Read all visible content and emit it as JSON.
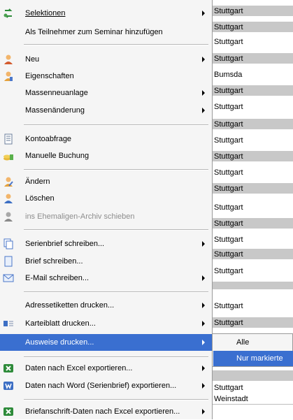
{
  "menu": {
    "items": [
      {
        "label": "Selektionen",
        "icon": "selection-icon",
        "submenu": true
      },
      {
        "label": "Als Teilnehmer zum Seminar hinzufügen"
      },
      {
        "label": "Neu",
        "icon": "new-person-icon",
        "submenu": true
      },
      {
        "label": "Eigenschaften",
        "icon": "properties-icon"
      },
      {
        "label": "Massenneuanlage",
        "submenu": true
      },
      {
        "label": "Massenänderung",
        "submenu": true
      },
      {
        "label": "Kontoabfrage",
        "icon": "account-query-icon"
      },
      {
        "label": "Manuelle Buchung",
        "icon": "manual-booking-icon"
      },
      {
        "label": "Ändern",
        "icon": "edit-person-icon"
      },
      {
        "label": "Löschen",
        "icon": "delete-person-icon"
      },
      {
        "label": "ins Ehemaligen-Archiv schieben",
        "icon": "archive-person-icon",
        "disabled": true
      },
      {
        "label": "Serienbrief schreiben...",
        "icon": "serial-letter-icon",
        "submenu": true
      },
      {
        "label": "Brief schreiben...",
        "icon": "letter-icon"
      },
      {
        "label": "E-Mail schreiben...",
        "icon": "email-icon",
        "submenu": true
      },
      {
        "label": "Adressetiketten drucken...",
        "submenu": true
      },
      {
        "label": "Karteiblatt drucken...",
        "icon": "index-card-icon",
        "submenu": true
      },
      {
        "label": "Ausweise drucken...",
        "submenu": true,
        "highlighted": true
      },
      {
        "label": "Daten nach Excel exportieren...",
        "icon": "excel-icon",
        "submenu": true
      },
      {
        "label": "Daten nach Word (Serienbrief) exportieren...",
        "icon": "word-icon",
        "submenu": true
      },
      {
        "label": "Briefanschrift-Daten nach Excel exportieren...",
        "icon": "excel-address-icon",
        "submenu": true
      }
    ]
  },
  "submenu": {
    "items": [
      {
        "label": "Alle"
      },
      {
        "label": "Nur markierte",
        "highlighted": true
      }
    ]
  },
  "grid": {
    "rows": [
      {
        "text": "Stuttgart"
      },
      {
        "text": "Stuttgart"
      },
      {
        "text": "Stuttgart"
      },
      {
        "text": "Stuttgart"
      },
      {
        "text": "Bumsda"
      },
      {
        "text": "Stuttgart"
      },
      {
        "text": "Stuttgart"
      },
      {
        "text": "Stuttgart"
      },
      {
        "text": "Stuttgart"
      },
      {
        "text": "Stuttgart"
      },
      {
        "text": "Stuttgart"
      },
      {
        "text": "Stuttgart"
      },
      {
        "text": "Stuttgart"
      },
      {
        "text": "Stuttgart"
      },
      {
        "text": "Stuttgart"
      },
      {
        "text": "Stuttgart"
      },
      {
        "text": "Stuttgart"
      },
      {
        "text": ""
      },
      {
        "text": ""
      },
      {
        "text": "Stuttgart"
      },
      {
        "text": "Stuttgart"
      },
      {
        "text": ""
      },
      {
        "text": ""
      },
      {
        "text": ""
      },
      {
        "text": ""
      },
      {
        "text": ""
      },
      {
        "text": ""
      },
      {
        "text": ""
      },
      {
        "text": "Stuttgart"
      },
      {
        "text": ""
      },
      {
        "text": ""
      },
      {
        "text": "Stuttgart"
      },
      {
        "text": "Weinstadt"
      }
    ]
  },
  "colors": {
    "highlight": "#3a6fd0",
    "menu_background": "#f5f5f5",
    "grid_alt_row": "#c8c8c8",
    "disabled_text": "#8d8d8d"
  }
}
